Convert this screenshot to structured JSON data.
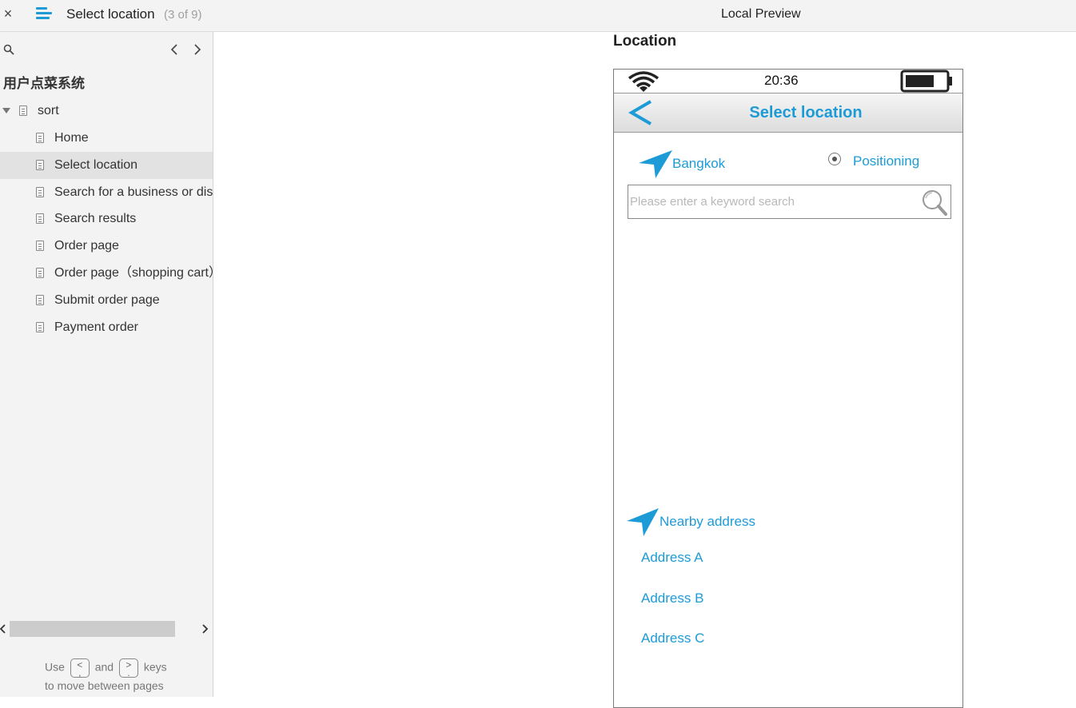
{
  "topbar": {
    "close_glyph": "×",
    "page_name": "Select location",
    "page_count": "(3 of 9)",
    "preview_title": "Local Preview"
  },
  "sidebar": {
    "project_title": "用户点菜系统",
    "root": "sort",
    "items": [
      {
        "label": "Home",
        "selected": false
      },
      {
        "label": "Select location",
        "selected": true
      },
      {
        "label": "Search for a business or dish",
        "selected": false
      },
      {
        "label": "Search results",
        "selected": false
      },
      {
        "label": "Order page",
        "selected": false
      },
      {
        "label": "Order page（shopping cart）",
        "selected": false
      },
      {
        "label": "Submit order page",
        "selected": false
      },
      {
        "label": "Payment order",
        "selected": false
      }
    ],
    "hint": {
      "use": "Use",
      "key_prev": "<\n,",
      "and": "and",
      "key_next": ">\n.",
      "keys": "keys",
      "line2": "to move between pages"
    }
  },
  "main": {
    "title": "Location",
    "phone": {
      "time": "20:36",
      "nav_title": "Select location",
      "city": "Bangkok",
      "positioning": "Positioning",
      "search_placeholder": "Please enter a keyword search",
      "search_value": "",
      "nearby_label": "Nearby address",
      "addresses": [
        "Address A",
        "Address B",
        "Address C"
      ]
    }
  },
  "colors": {
    "accent": "#1d9bd7",
    "sidebar_bg": "#f3f3f3",
    "selected_bg": "#e2e2e2"
  }
}
